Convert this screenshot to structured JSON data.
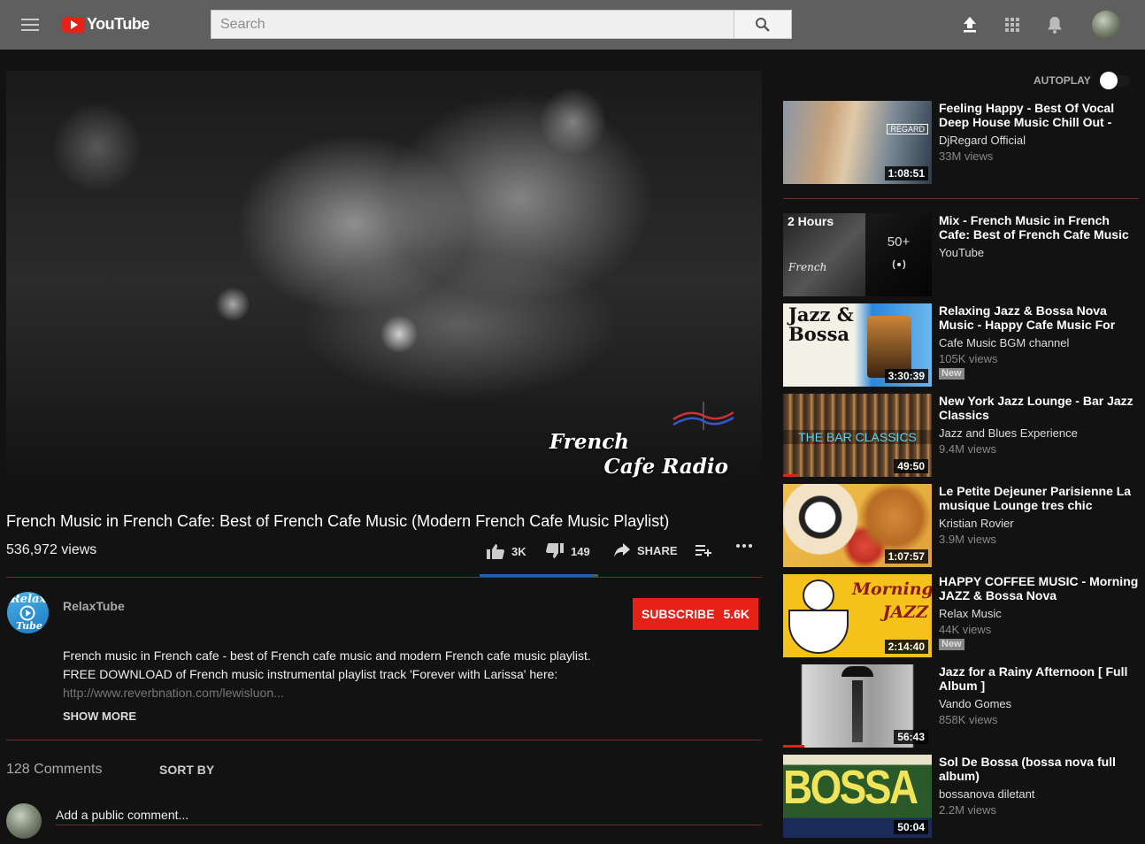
{
  "header": {
    "logo_text": "YouTube",
    "search_placeholder": "Search"
  },
  "video": {
    "title": "French Music in French Cafe: Best of French Cafe Music (Modern French Cafe Music Playlist)",
    "views": "536,972 views",
    "overlay_line1": "French",
    "overlay_line2": "Cafe Radio",
    "likes": "3K",
    "dislikes": "149",
    "share_label": "SHARE",
    "like_ratio": 0.953
  },
  "channel": {
    "name": "RelaxTube",
    "avatar_text1": "Relax",
    "avatar_text2": "Tube",
    "subscribe_label": "SUBSCRIBE",
    "subscriber_count": "5.6K"
  },
  "description": {
    "line1": "French music in French cafe - best of French cafe music and modern French cafe music playlist.",
    "line2": "FREE DOWNLOAD of French music instrumental playlist track 'Forever with Larissa' here:",
    "link": "http://www.reverbnation.com/lewisluon...",
    "show_more": "SHOW MORE"
  },
  "comments": {
    "count": "128 Comments",
    "sort_label": "SORT BY",
    "placeholder": "Add a public comment..."
  },
  "sidebar": {
    "autoplay_label": "AUTOPLAY",
    "autoplay_on": false,
    "items": [
      {
        "title": "Feeling Happy - Best Of Vocal Deep House Music Chill Out -",
        "channel": "DjRegard Official",
        "views": "33M views",
        "duration": "1:08:51",
        "thumb_text": "REGARD",
        "new": false
      },
      {
        "title": "Mix - French Music in French Cafe: Best of French Cafe Music (Modern",
        "channel": "YouTube",
        "views": "",
        "duration": "",
        "thumb_text": "2 Hours",
        "playlist_count": "50+",
        "new": false
      },
      {
        "title": "Relaxing Jazz & Bossa Nova Music - Happy Cafe Music For",
        "channel": "Cafe Music BGM channel",
        "views": "105K views",
        "duration": "3:30:39",
        "thumb_text": "Jazz & Bossa",
        "new": true
      },
      {
        "title": "New York Jazz Lounge - Bar Jazz Classics",
        "channel": "Jazz and Blues Experience",
        "views": "9.4M views",
        "duration": "49:50",
        "thumb_text": "THE BAR CLASSICS",
        "new": false,
        "progress": 0.1
      },
      {
        "title": "Le Petite Dejeuner Parisienne La musique Lounge tres chic",
        "channel": "Kristian Rovier",
        "views": "3.9M views",
        "duration": "1:07:57",
        "thumb_text": "",
        "new": false
      },
      {
        "title": "HAPPY COFFEE MUSIC - Morning JAZZ & Bossa Nova",
        "channel": "Relax Music",
        "views": "44K views",
        "duration": "2:14:40",
        "thumb_text": "Morning JAZZ",
        "new": true
      },
      {
        "title": "Jazz for a Rainy Afternoon [ Full Album ]",
        "channel": "Vando Gomes",
        "views": "858K views",
        "duration": "56:43",
        "thumb_text": "",
        "new": false,
        "progress": 0.14
      },
      {
        "title": "Sol De Bossa (bossa nova full album)",
        "channel": "bossanova diletant",
        "views": "2.2M views",
        "duration": "50:04",
        "thumb_text": "BOSSA",
        "new": false
      }
    ],
    "new_label": "New"
  }
}
